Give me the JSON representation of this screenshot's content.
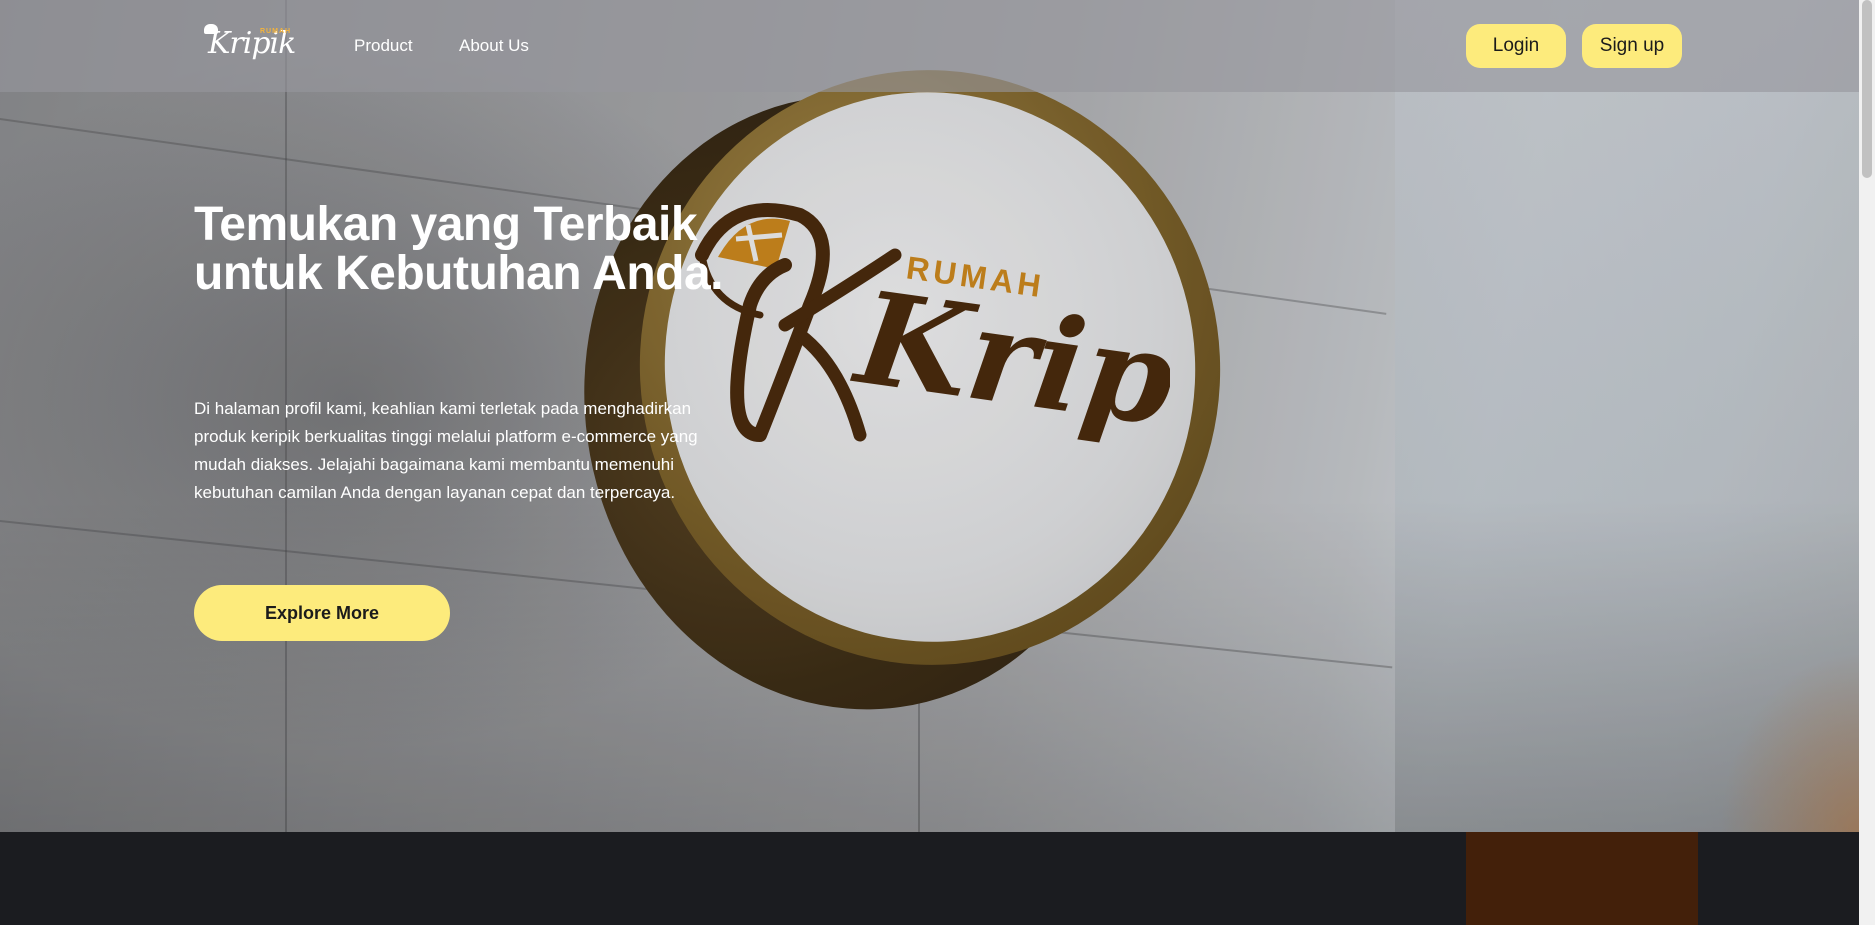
{
  "nav": {
    "brand": "Kripik",
    "brand_small": "RUMAH",
    "links": [
      "Product",
      "About Us"
    ],
    "login_label": "Login",
    "signup_label": "Sign up"
  },
  "hero": {
    "title": "Temukan yang Terbaik untuk Kebutuhan Anda.",
    "description": "Di halaman profil kami, keahlian kami terletak pada menghadirkan produk keripik berkualitas tinggi melalui platform e-commerce yang mudah diakses. Jelajahi bagaimana kami membantu memenuhi kebutuhan camilan Anda dengan layanan cepat dan terpercaya.",
    "cta_label": "Explore More",
    "sign_logo_small": "RUMAH",
    "sign_logo_main": "Kripik"
  },
  "colors": {
    "accent_yellow": "#fdeb7c",
    "dark_bg": "#1b1c20",
    "brown_card": "#43200a",
    "logo_brown": "#4a2a0c",
    "logo_gold": "#d08a1c"
  },
  "icons": {
    "brand": "brand-logo-icon",
    "sign": "sign-logo-icon"
  }
}
